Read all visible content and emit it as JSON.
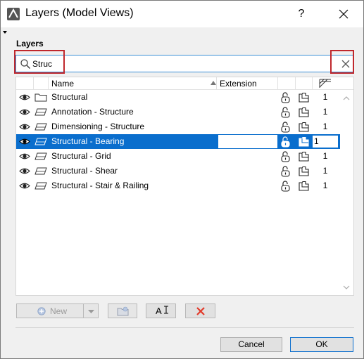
{
  "window": {
    "title": "Layers (Model Views)",
    "help_label": "?",
    "section_label": "Layers"
  },
  "search": {
    "value": "Struc",
    "placeholder": ""
  },
  "table": {
    "columns": {
      "name": "Name",
      "extension": "Extension"
    },
    "rows": [
      {
        "name": "Structural",
        "type": "folder-icon",
        "extension": "",
        "intersection": "1",
        "selected": false
      },
      {
        "name": "Annotation - Structure",
        "type": "layer-icon",
        "extension": "",
        "intersection": "1",
        "selected": false
      },
      {
        "name": "Dimensioning - Structure",
        "type": "layer-icon",
        "extension": "",
        "intersection": "1",
        "selected": false
      },
      {
        "name": "Structural - Bearing",
        "type": "layer-icon",
        "extension": "",
        "intersection": "1",
        "selected": true
      },
      {
        "name": "Structural - Grid",
        "type": "layer-icon",
        "extension": "",
        "intersection": "1",
        "selected": false
      },
      {
        "name": "Structural - Shear",
        "type": "layer-icon",
        "extension": "",
        "intersection": "1",
        "selected": false
      },
      {
        "name": "Structural - Stair & Railing",
        "type": "layer-icon",
        "extension": "",
        "intersection": "1",
        "selected": false
      }
    ]
  },
  "toolbar": {
    "new_label": "New",
    "rename_label": "A"
  },
  "footer": {
    "cancel_label": "Cancel",
    "ok_label": "OK"
  },
  "colors": {
    "selection": "#0a6ecd",
    "highlight": "#c0282d",
    "focus_border": "#3c8fd6",
    "delete_red": "#e23a2a"
  }
}
